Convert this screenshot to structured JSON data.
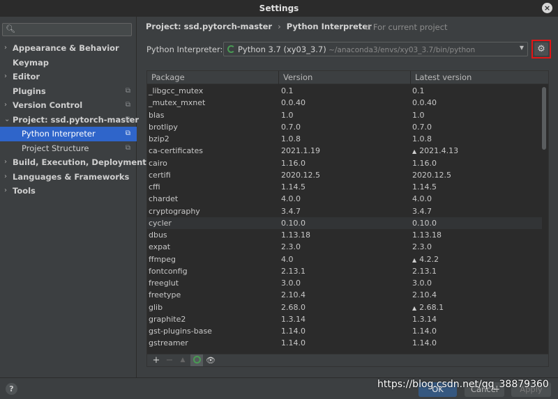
{
  "window": {
    "title": "Settings",
    "close_label": "×"
  },
  "sidebar": {
    "search_placeholder": "",
    "search_icon": "search-icon",
    "items": [
      {
        "label": "Appearance & Behavior",
        "arrow": "›"
      },
      {
        "label": "Keymap"
      },
      {
        "label": "Editor",
        "arrow": "›"
      },
      {
        "label": "Plugins",
        "copy": "⧉"
      },
      {
        "label": "Version Control",
        "arrow": "›",
        "copy": "⧉"
      },
      {
        "label": "Project: ssd.pytorch-master",
        "arrow": "⌄",
        "copy": "⧉"
      },
      {
        "label": "Python Interpreter",
        "copy": "⧉"
      },
      {
        "label": "Project Structure",
        "copy": "⧉"
      },
      {
        "label": "Build, Execution, Deployment",
        "arrow": "›"
      },
      {
        "label": "Languages & Frameworks",
        "arrow": "›"
      },
      {
        "label": "Tools",
        "arrow": "›"
      }
    ]
  },
  "breadcrumb": {
    "project": "Project: ssd.pytorch-master",
    "separator": "›",
    "page": "Python Interpreter",
    "scope": "⧉ For current project"
  },
  "interpreter": {
    "label": "Python Interpreter:",
    "name": "Python 3.7 (xy03_3.7)",
    "path": " ~/anaconda3/envs/xy03_3.7/bin/python",
    "caret": "▼",
    "gear": "⚙"
  },
  "packages": {
    "columns": [
      "Package",
      "Version",
      "Latest version"
    ],
    "up_glyph": "▲",
    "rows": [
      {
        "name": "_libgcc_mutex",
        "version": "0.1",
        "latest": "0.1"
      },
      {
        "name": "_mutex_mxnet",
        "version": "0.0.40",
        "latest": "0.0.40"
      },
      {
        "name": "blas",
        "version": "1.0",
        "latest": "1.0"
      },
      {
        "name": "brotlipy",
        "version": "0.7.0",
        "latest": "0.7.0"
      },
      {
        "name": "bzip2",
        "version": "1.0.8",
        "latest": "1.0.8"
      },
      {
        "name": "ca-certificates",
        "version": "2021.1.19",
        "latest": "2021.4.13",
        "upgrade": true
      },
      {
        "name": "cairo",
        "version": "1.16.0",
        "latest": "1.16.0"
      },
      {
        "name": "certifi",
        "version": "2020.12.5",
        "latest": "2020.12.5"
      },
      {
        "name": "cffi",
        "version": "1.14.5",
        "latest": "1.14.5"
      },
      {
        "name": "chardet",
        "version": "4.0.0",
        "latest": "4.0.0"
      },
      {
        "name": "cryptography",
        "version": "3.4.7",
        "latest": "3.4.7"
      },
      {
        "name": "cycler",
        "version": "0.10.0",
        "latest": "0.10.0",
        "highlighted": true
      },
      {
        "name": "dbus",
        "version": "1.13.18",
        "latest": "1.13.18"
      },
      {
        "name": "expat",
        "version": "2.3.0",
        "latest": "2.3.0"
      },
      {
        "name": "ffmpeg",
        "version": "4.0",
        "latest": "4.2.2",
        "upgrade": true
      },
      {
        "name": "fontconfig",
        "version": "2.13.1",
        "latest": "2.13.1"
      },
      {
        "name": "freeglut",
        "version": "3.0.0",
        "latest": "3.0.0"
      },
      {
        "name": "freetype",
        "version": "2.10.4",
        "latest": "2.10.4"
      },
      {
        "name": "glib",
        "version": "2.68.0",
        "latest": "2.68.1",
        "upgrade": true
      },
      {
        "name": "graphite2",
        "version": "1.3.14",
        "latest": "1.3.14"
      },
      {
        "name": "gst-plugins-base",
        "version": "1.14.0",
        "latest": "1.14.0"
      },
      {
        "name": "gstreamer",
        "version": "1.14.0",
        "latest": "1.14.0"
      }
    ]
  },
  "toolbar": {
    "add": "+",
    "remove": "−",
    "upgrade": "▲",
    "show_early": "👁"
  },
  "footer": {
    "help": "?",
    "ok": "OK",
    "cancel": "Cancel",
    "apply": "Apply"
  },
  "watermark": "https://blog.csdn.net/qq_38879360"
}
